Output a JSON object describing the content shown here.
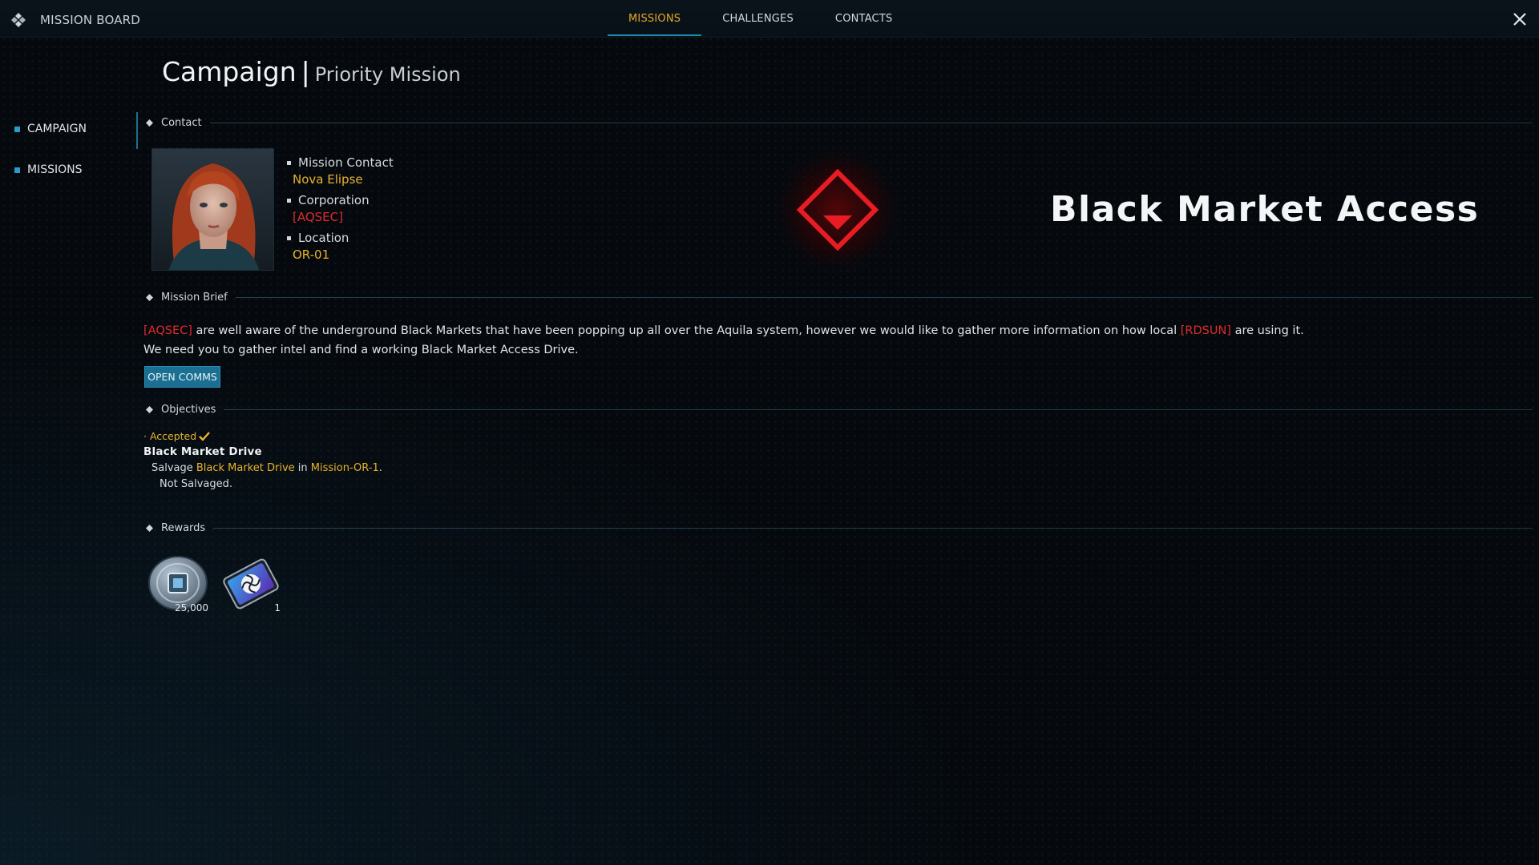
{
  "app": {
    "title": "MISSION BOARD"
  },
  "tabs": [
    {
      "label": "MISSIONS",
      "active": true
    },
    {
      "label": "CHALLENGES",
      "active": false
    },
    {
      "label": "CONTACTS",
      "active": false
    }
  ],
  "sidebar": {
    "items": [
      {
        "label": "CAMPAIGN"
      },
      {
        "label": "MISSIONS"
      }
    ]
  },
  "page": {
    "title": "Campaign",
    "separator": "|",
    "subtitle": "Priority Mission"
  },
  "sections": {
    "contact": "Contact",
    "brief": "Mission Brief",
    "objectives": "Objectives",
    "rewards": "Rewards"
  },
  "contact": {
    "mission_contact_label": "Mission Contact",
    "mission_contact_value": "Nova Elipse",
    "corporation_label": "Corporation",
    "corporation_value": "[AQSEC]",
    "location_label": "Location",
    "location_value": "OR-01"
  },
  "mission": {
    "name": "Black Market Access"
  },
  "brief": {
    "tag1": "[AQSEC]",
    "text1": " are well aware of the underground Black Markets that have been popping up all over the Aquila system, however we would like to gather more information on how local ",
    "tag2": "[RDSUN]",
    "text2": " are using it.",
    "line2": "We need you to gather intel and find a working Black Market Access Drive.",
    "button": "OPEN COMMS"
  },
  "objectives": {
    "status": "· Accepted",
    "title": "Black Market Drive",
    "task_prefix": "Salvage ",
    "task_item": "Black Market Drive",
    "task_mid": " in ",
    "task_location": "Mission-OR-1",
    "task_suffix": ".",
    "progress": "Not Salvaged."
  },
  "rewards": [
    {
      "icon": "credits-chip-icon",
      "qty": "25,000"
    },
    {
      "icon": "access-drive-icon",
      "qty": "1"
    }
  ],
  "colors": {
    "accent_gold": "#e8b32d",
    "accent_blue": "#1f8ab0",
    "faction_red": "#e02b2b",
    "background": "#05090e"
  }
}
